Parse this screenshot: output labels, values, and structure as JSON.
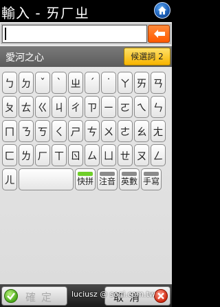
{
  "title": "輸入 - ㄞㄏㄓ",
  "input": {
    "value": ""
  },
  "phrase": "愛河之心",
  "candidate_button": "候選詞 2",
  "keys": {
    "row1": [
      "ㄅ",
      "ㄉ",
      "ˇ",
      "ˋ",
      "ㄓ",
      "ˊ",
      "˙",
      "ㄚ",
      "ㄞ",
      "ㄢ"
    ],
    "row2": [
      "ㄆ",
      "ㄊ",
      "ㄍ",
      "ㄐ",
      "ㄔ",
      "ㄗ",
      "ㄧ",
      "ㄛ",
      "ㄟ",
      "ㄣ"
    ],
    "row3": [
      "ㄇ",
      "ㄋ",
      "ㄎ",
      "ㄑ",
      "ㄕ",
      "ㄘ",
      "ㄨ",
      "ㄜ",
      "ㄠ",
      "ㄤ"
    ],
    "row4": [
      "ㄈ",
      "ㄌ",
      "ㄏ",
      "ㄒ",
      "ㄖ",
      "ㄙ",
      "ㄩ",
      "ㄝ",
      "ㄡ",
      "ㄥ"
    ],
    "er": "ㄦ"
  },
  "modes": [
    {
      "label": "快拼",
      "active": true
    },
    {
      "label": "注音",
      "active": false
    },
    {
      "label": "英數",
      "active": false
    },
    {
      "label": "手寫",
      "active": false
    }
  ],
  "confirm_label": "確定",
  "cancel_label": "取消",
  "watermark": "luciusz @ sogi.com.tw",
  "colors": {
    "backspace": "#ff5a00",
    "candidate": "#f7b400",
    "active_mode": "#6fcf2a"
  }
}
